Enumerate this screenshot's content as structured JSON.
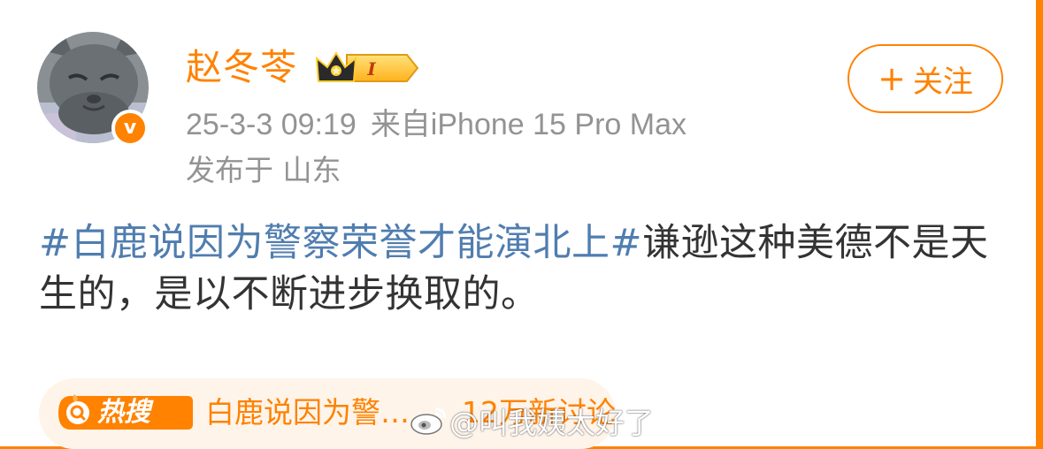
{
  "post": {
    "author": {
      "name": "赵冬苓",
      "avatar_icon": "cat-avatar",
      "verified_badge": "v",
      "level_badge": "crown-level-badge",
      "level_label": "I"
    },
    "timestamp": "25-3-3 09:19",
    "source": "来自iPhone 15 Pro Max",
    "location": "发布于 山东",
    "follow_button": {
      "plus": "+",
      "label": "关注"
    },
    "topic": "#白鹿说因为警察荣誉才能演北上#",
    "body": "谦逊这种美德不是天生的，是以不断进步换取的。"
  },
  "hot_search": {
    "icon_label": "热搜",
    "title": "白鹿说因为警…",
    "count": "12万新讨论"
  },
  "watermark": {
    "text": "@叫我姨太好了"
  },
  "colors": {
    "accent": "#ff8200",
    "link": "#507daf",
    "meta": "#939393",
    "text": "#333333",
    "hot_bg": "#fff4ea"
  }
}
